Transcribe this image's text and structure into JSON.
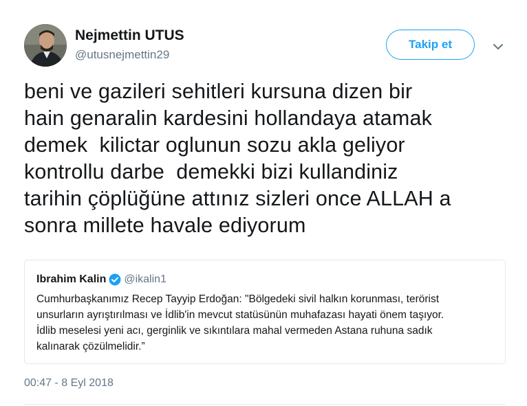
{
  "author": {
    "name": "Nejmettin UTUS",
    "handle": "@utusnejmettin29"
  },
  "follow_button": {
    "label": "Takip et"
  },
  "tweet": {
    "lines": [
      "beni ve gazileri sehitleri kursuna dizen bir",
      "hain genaralin kardesini hollandaya atamak",
      "demek  kilictar oglunun sozu akla geliyor",
      "kontrollu darbe  demekki bizi kullandiniz",
      "tarihin çöplüğüne attınız sizleri once ALLAH a",
      "sonra millete havale ediyorum"
    ]
  },
  "quoted_tweet": {
    "name": "Ibrahim Kalin",
    "handle": "@ikalin1",
    "lines": [
      "Cumhurbaşkanımız Recep Tayyip Erdoğan: \"Bölgedeki sivil halkın korunması, terörist",
      "unsurların ayrıştırılması ve İdlib'in mevcut statüsünün muhafazası hayati önem taşıyor.",
      "İdlib meselesi yeni acı, gerginlik ve sıkıntılara mahal vermeden Astana ruhuna sadık",
      "kalınarak çözülmelidir.”"
    ]
  },
  "timestamp": "00:47 - 8 Eyl 2018",
  "icons": {
    "verified": "verified-badge-icon",
    "caret": "chevron-down-icon"
  },
  "colors": {
    "accent": "#1da1f2",
    "text": "#14171a",
    "secondary": "#657786",
    "border": "#e1e8ed"
  }
}
